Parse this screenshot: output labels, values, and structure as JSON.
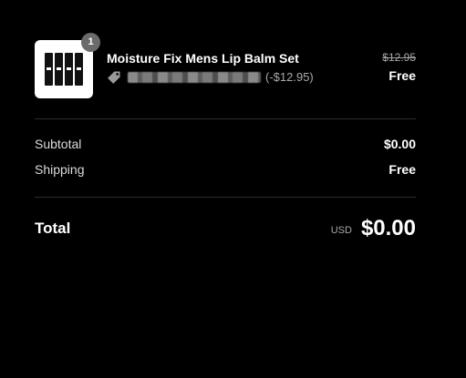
{
  "line_item": {
    "quantity": "1",
    "name": "Moisture Fix Mens Lip Balm Set",
    "discount_amount": "(-$12.95)",
    "original_price": "$12.95",
    "current_price": "Free",
    "tag_icon": "tag-icon"
  },
  "summary": {
    "subtotal_label": "Subtotal",
    "subtotal_value": "$0.00",
    "shipping_label": "Shipping",
    "shipping_value": "Free"
  },
  "total": {
    "label": "Total",
    "currency": "USD",
    "value": "$0.00"
  },
  "colors": {
    "background": "#000000",
    "divider": "#2c2c2c",
    "muted_text": "#a8a8a8",
    "badge": "#6b6b6b"
  }
}
